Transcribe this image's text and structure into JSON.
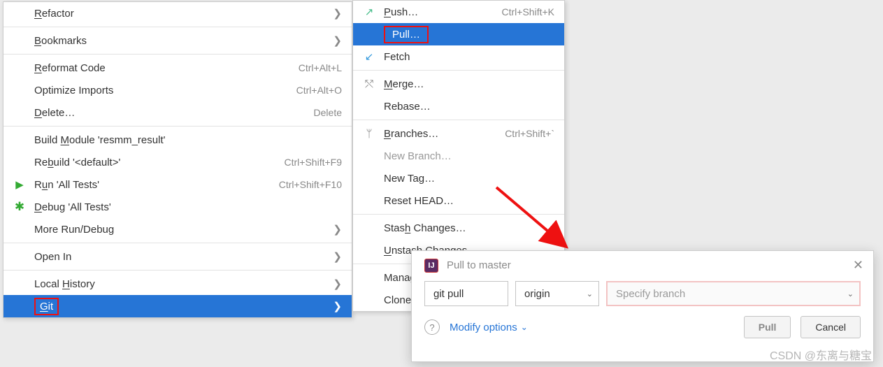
{
  "menu1": {
    "items": [
      {
        "label": "Refactor",
        "type": "sub",
        "underline": "R"
      },
      {
        "label": "Bookmarks",
        "type": "sub",
        "underline": "B"
      },
      {
        "label": "Reformat Code",
        "shortcut": "Ctrl+Alt+L",
        "underline": "R"
      },
      {
        "label": "Optimize Imports",
        "shortcut": "Ctrl+Alt+O"
      },
      {
        "label": "Delete…",
        "shortcut": "Delete",
        "underline": "D"
      },
      {
        "label": "Build Module 'resmm_result'",
        "underline": "M"
      },
      {
        "label": "Rebuild '<default>'",
        "shortcut": "Ctrl+Shift+F9",
        "underline": "b"
      },
      {
        "label": "Run 'All Tests'",
        "shortcut": "Ctrl+Shift+F10",
        "underline": "u",
        "icon": "run"
      },
      {
        "label": "Debug 'All Tests'",
        "underline": "D",
        "icon": "debug"
      },
      {
        "label": "More Run/Debug",
        "type": "sub"
      },
      {
        "label": "Open In",
        "type": "sub"
      },
      {
        "label": "Local History",
        "type": "sub",
        "underline": "H"
      },
      {
        "label": "Git",
        "type": "sub",
        "underline": "G",
        "selected": true,
        "boxed": true
      }
    ]
  },
  "menu2": {
    "items": [
      {
        "label": "Push…",
        "shortcut": "Ctrl+Shift+K",
        "underline": "P",
        "icon": "push"
      },
      {
        "label": "Pull…",
        "selected": true,
        "boxed": true
      },
      {
        "label": "Fetch",
        "icon": "fetch"
      },
      {
        "label": "Merge…",
        "underline": "M",
        "icon": "merge"
      },
      {
        "label": "Rebase…"
      },
      {
        "label": "Branches…",
        "shortcut": "Ctrl+Shift+`",
        "underline": "B",
        "icon": "branch"
      },
      {
        "label": "New Branch…",
        "dim": true
      },
      {
        "label": "New Tag…"
      },
      {
        "label": "Reset HEAD…"
      },
      {
        "label": "Stash Changes…",
        "underline": "h"
      },
      {
        "label": "Unstash Changes…",
        "underline": "U"
      },
      {
        "label": "Manage Remotes…",
        "underline": "g"
      },
      {
        "label": "Clone…"
      }
    ]
  },
  "dialog": {
    "title": "Pull to master",
    "cmd": "git pull",
    "remote": "origin",
    "branch_placeholder": "Specify branch",
    "modify": "Modify options",
    "primary": "Pull",
    "cancel": "Cancel"
  },
  "watermark": "CSDN @东离与糖宝"
}
